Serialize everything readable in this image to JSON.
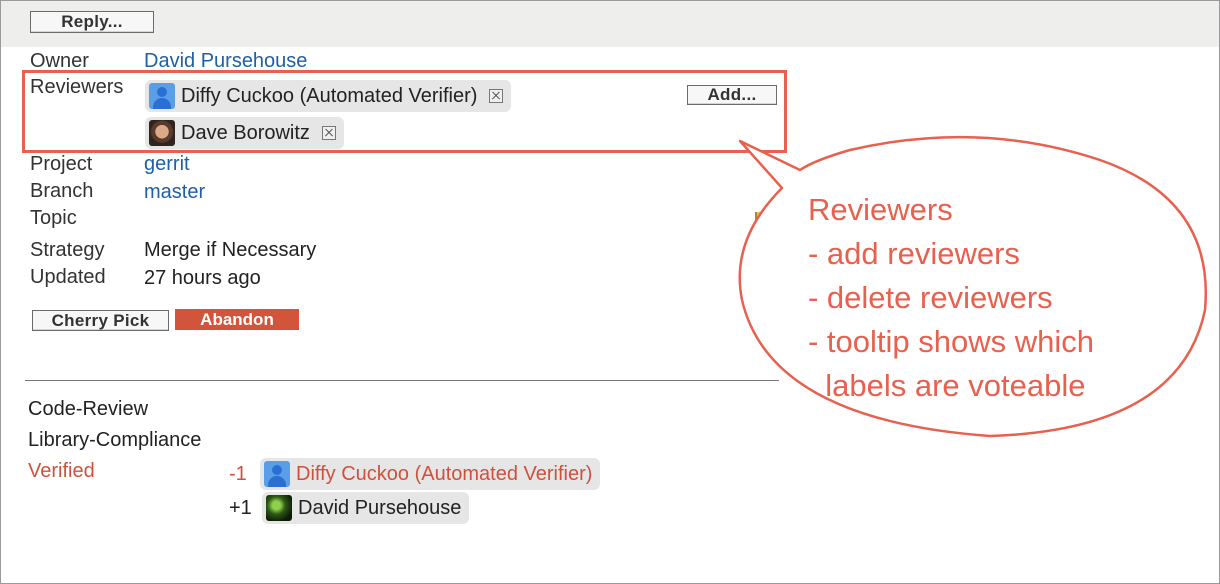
{
  "toolbar": {
    "reply_label": "Reply..."
  },
  "info": {
    "owner_label": "Owner",
    "owner_value": "David Pursehouse",
    "reviewers_label": "Reviewers",
    "reviewers": [
      {
        "name": "Diffy Cuckoo (Automated Verifier)",
        "avatar": "generic-user-icon"
      },
      {
        "name": "Dave Borowitz",
        "avatar": "photo-avatar"
      }
    ],
    "add_label": "Add...",
    "project_label": "Project",
    "project_value": "gerrit",
    "branch_label": "Branch",
    "branch_value": "master",
    "topic_label": "Topic",
    "strategy_label": "Strategy",
    "strategy_value": "Merge if Necessary",
    "updated_label": "Updated",
    "updated_value": "27 hours ago"
  },
  "actions": {
    "cherry_pick_label": "Cherry Pick",
    "abandon_label": "Abandon"
  },
  "labels": {
    "code_review": "Code-Review",
    "library_compliance": "Library-Compliance",
    "verified": "Verified",
    "votes": [
      {
        "score": "-1",
        "name": "Diffy Cuckoo (Automated Verifier)"
      },
      {
        "score": "+1",
        "name": "David Pursehouse"
      }
    ]
  },
  "callout": {
    "lines": [
      "Reviewers",
      "- add reviewers",
      "- delete reviewers",
      "- tooltip shows which",
      "  labels are voteable"
    ],
    "color": "#e8604e"
  },
  "colors": {
    "link": "#1f5fa8",
    "abandon": "#d2543b",
    "verified": "#d0503d"
  }
}
